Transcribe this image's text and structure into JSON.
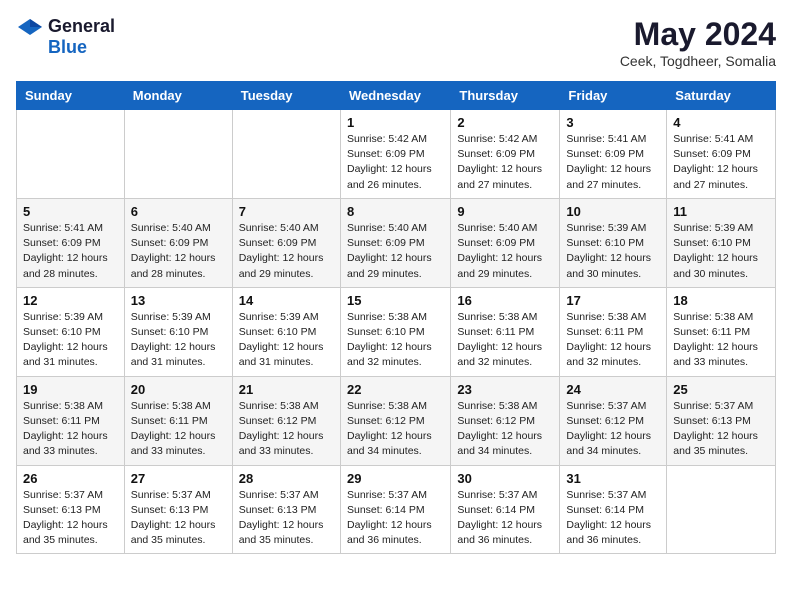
{
  "logo": {
    "general": "General",
    "blue": "Blue"
  },
  "title": "May 2024",
  "location": "Ceek, Togdheer, Somalia",
  "days_of_week": [
    "Sunday",
    "Monday",
    "Tuesday",
    "Wednesday",
    "Thursday",
    "Friday",
    "Saturday"
  ],
  "weeks": [
    [
      {
        "day": "",
        "info": ""
      },
      {
        "day": "",
        "info": ""
      },
      {
        "day": "",
        "info": ""
      },
      {
        "day": "1",
        "info": "Sunrise: 5:42 AM\nSunset: 6:09 PM\nDaylight: 12 hours\nand 26 minutes."
      },
      {
        "day": "2",
        "info": "Sunrise: 5:42 AM\nSunset: 6:09 PM\nDaylight: 12 hours\nand 27 minutes."
      },
      {
        "day": "3",
        "info": "Sunrise: 5:41 AM\nSunset: 6:09 PM\nDaylight: 12 hours\nand 27 minutes."
      },
      {
        "day": "4",
        "info": "Sunrise: 5:41 AM\nSunset: 6:09 PM\nDaylight: 12 hours\nand 27 minutes."
      }
    ],
    [
      {
        "day": "5",
        "info": "Sunrise: 5:41 AM\nSunset: 6:09 PM\nDaylight: 12 hours\nand 28 minutes."
      },
      {
        "day": "6",
        "info": "Sunrise: 5:40 AM\nSunset: 6:09 PM\nDaylight: 12 hours\nand 28 minutes."
      },
      {
        "day": "7",
        "info": "Sunrise: 5:40 AM\nSunset: 6:09 PM\nDaylight: 12 hours\nand 29 minutes."
      },
      {
        "day": "8",
        "info": "Sunrise: 5:40 AM\nSunset: 6:09 PM\nDaylight: 12 hours\nand 29 minutes."
      },
      {
        "day": "9",
        "info": "Sunrise: 5:40 AM\nSunset: 6:09 PM\nDaylight: 12 hours\nand 29 minutes."
      },
      {
        "day": "10",
        "info": "Sunrise: 5:39 AM\nSunset: 6:10 PM\nDaylight: 12 hours\nand 30 minutes."
      },
      {
        "day": "11",
        "info": "Sunrise: 5:39 AM\nSunset: 6:10 PM\nDaylight: 12 hours\nand 30 minutes."
      }
    ],
    [
      {
        "day": "12",
        "info": "Sunrise: 5:39 AM\nSunset: 6:10 PM\nDaylight: 12 hours\nand 31 minutes."
      },
      {
        "day": "13",
        "info": "Sunrise: 5:39 AM\nSunset: 6:10 PM\nDaylight: 12 hours\nand 31 minutes."
      },
      {
        "day": "14",
        "info": "Sunrise: 5:39 AM\nSunset: 6:10 PM\nDaylight: 12 hours\nand 31 minutes."
      },
      {
        "day": "15",
        "info": "Sunrise: 5:38 AM\nSunset: 6:10 PM\nDaylight: 12 hours\nand 32 minutes."
      },
      {
        "day": "16",
        "info": "Sunrise: 5:38 AM\nSunset: 6:11 PM\nDaylight: 12 hours\nand 32 minutes."
      },
      {
        "day": "17",
        "info": "Sunrise: 5:38 AM\nSunset: 6:11 PM\nDaylight: 12 hours\nand 32 minutes."
      },
      {
        "day": "18",
        "info": "Sunrise: 5:38 AM\nSunset: 6:11 PM\nDaylight: 12 hours\nand 33 minutes."
      }
    ],
    [
      {
        "day": "19",
        "info": "Sunrise: 5:38 AM\nSunset: 6:11 PM\nDaylight: 12 hours\nand 33 minutes."
      },
      {
        "day": "20",
        "info": "Sunrise: 5:38 AM\nSunset: 6:11 PM\nDaylight: 12 hours\nand 33 minutes."
      },
      {
        "day": "21",
        "info": "Sunrise: 5:38 AM\nSunset: 6:12 PM\nDaylight: 12 hours\nand 33 minutes."
      },
      {
        "day": "22",
        "info": "Sunrise: 5:38 AM\nSunset: 6:12 PM\nDaylight: 12 hours\nand 34 minutes."
      },
      {
        "day": "23",
        "info": "Sunrise: 5:38 AM\nSunset: 6:12 PM\nDaylight: 12 hours\nand 34 minutes."
      },
      {
        "day": "24",
        "info": "Sunrise: 5:37 AM\nSunset: 6:12 PM\nDaylight: 12 hours\nand 34 minutes."
      },
      {
        "day": "25",
        "info": "Sunrise: 5:37 AM\nSunset: 6:13 PM\nDaylight: 12 hours\nand 35 minutes."
      }
    ],
    [
      {
        "day": "26",
        "info": "Sunrise: 5:37 AM\nSunset: 6:13 PM\nDaylight: 12 hours\nand 35 minutes."
      },
      {
        "day": "27",
        "info": "Sunrise: 5:37 AM\nSunset: 6:13 PM\nDaylight: 12 hours\nand 35 minutes."
      },
      {
        "day": "28",
        "info": "Sunrise: 5:37 AM\nSunset: 6:13 PM\nDaylight: 12 hours\nand 35 minutes."
      },
      {
        "day": "29",
        "info": "Sunrise: 5:37 AM\nSunset: 6:14 PM\nDaylight: 12 hours\nand 36 minutes."
      },
      {
        "day": "30",
        "info": "Sunrise: 5:37 AM\nSunset: 6:14 PM\nDaylight: 12 hours\nand 36 minutes."
      },
      {
        "day": "31",
        "info": "Sunrise: 5:37 AM\nSunset: 6:14 PM\nDaylight: 12 hours\nand 36 minutes."
      },
      {
        "day": "",
        "info": ""
      }
    ]
  ]
}
